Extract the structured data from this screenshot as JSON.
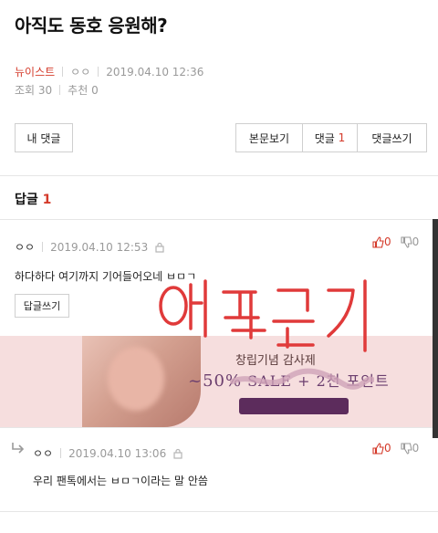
{
  "post": {
    "title": "아직도 동호 응원해?",
    "category": "뉴이스트",
    "author": "ㅇㅇ",
    "datetime": "2019.04.10 12:36",
    "views": "조회 30",
    "recommends": "추천 0"
  },
  "buttons": {
    "my_comments": "내 댓글",
    "view_post": "본문보기",
    "comments_label": "댓글",
    "comments_count": "1",
    "write_comment": "댓글쓰기"
  },
  "replies_header": {
    "label": "답글",
    "count": "1"
  },
  "comments": [
    {
      "author": "ㅇㅇ",
      "datetime": "2019.04.10 12:53",
      "text": "하다하다 여기까지 기어들어오네 ㅂㅁㄱ",
      "up": "0",
      "down": "0",
      "reply_button": "답글쓰기"
    },
    {
      "author": "ㅇㅇ",
      "datetime": "2019.04.10 13:06",
      "text": "우리 팬톡에서는 ㅂㅁㄱ이라는 말 안씀",
      "up": "0",
      "down": "0"
    }
  ],
  "banner": {
    "line1": "창립기념 감사제",
    "line2a": "~50%",
    "line2b": " SALE",
    "line2c": " + 2천 포인트"
  },
  "overlay_text": "언터금지",
  "colors": {
    "accent": "#d43a2a",
    "banner_bg": "#f6dede",
    "banner_text": "#6b3e6e"
  },
  "icons": [
    "lock-icon",
    "thumbs-up-icon",
    "thumbs-down-icon",
    "reply-arrow-icon"
  ]
}
